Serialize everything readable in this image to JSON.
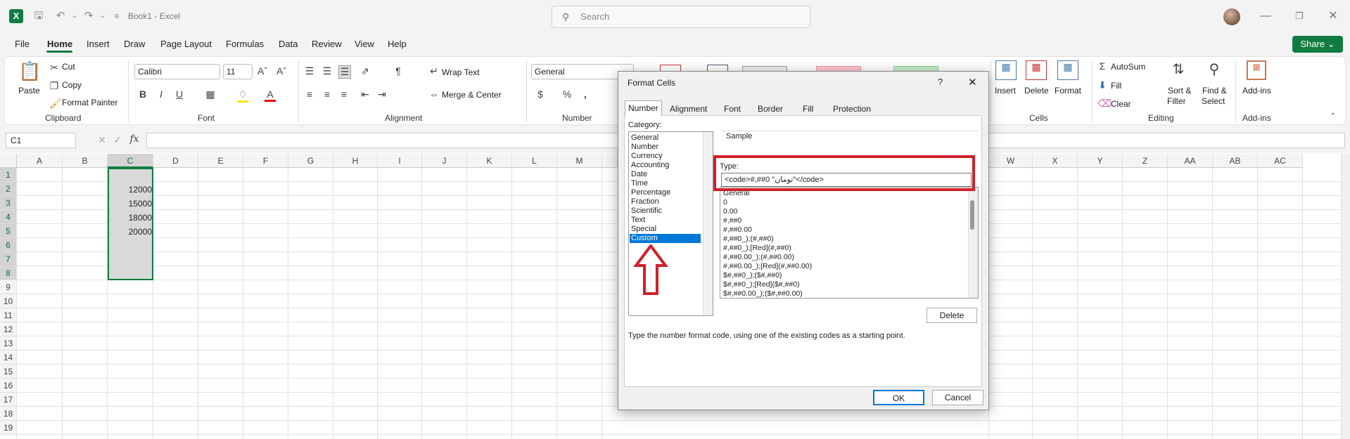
{
  "window": {
    "title": "Book1  -  Excel",
    "search_placeholder": "Search"
  },
  "menu": [
    "File",
    "Home",
    "Insert",
    "Draw",
    "Page Layout",
    "Formulas",
    "Data",
    "Review",
    "View",
    "Help"
  ],
  "share_label": "Share",
  "ribbon": {
    "paste": "Paste",
    "cut": "Cut",
    "copy": "Copy",
    "format_painter": "Format Painter",
    "clipboard": "Clipboard",
    "font_name": "Calibri",
    "font_size": "11",
    "font_group": "Font",
    "wrap_text": "Wrap Text",
    "merge_center": "Merge & Center",
    "alignment_group": "Alignment",
    "number_format": "General",
    "number_group": "Number",
    "insert": "Insert",
    "delete": "Delete",
    "format": "Format",
    "cells_group": "Cells",
    "autosum": "AutoSum",
    "fill": "Fill",
    "clear": "Clear",
    "sort_filter_1": "Sort &",
    "sort_filter_2": "Filter",
    "find_select_1": "Find &",
    "find_select_2": "Select",
    "editing_group": "Editing",
    "addins": "Add-ins",
    "addins_group": "Add-ins"
  },
  "name_box": "C1",
  "columns": [
    "A",
    "B",
    "C",
    "D",
    "E",
    "F",
    "G",
    "H",
    "I",
    "J",
    "K",
    "L",
    "M"
  ],
  "columns_right": [
    "X",
    "Y",
    "Z",
    "AA",
    "AB",
    "AC"
  ],
  "col_w": "W",
  "rows": [
    "1",
    "2",
    "3",
    "4",
    "5",
    "6",
    "7",
    "8",
    "9",
    "10",
    "11",
    "12",
    "13",
    "14",
    "15",
    "16",
    "17",
    "18",
    "19"
  ],
  "cells": {
    "c2": "12000",
    "c3": "15000",
    "c4": "18000",
    "c5": "20000"
  },
  "dialog": {
    "title": "Format Cells",
    "help": "?",
    "close": "✕",
    "tabs": [
      "Number",
      "Alignment",
      "Font",
      "Border",
      "Fill",
      "Protection"
    ],
    "category_label": "Category:",
    "categories": [
      "General",
      "Number",
      "Currency",
      "Accounting",
      "Date",
      "Time",
      "Percentage",
      "Fraction",
      "Scientific",
      "Text",
      "Special",
      "Custom"
    ],
    "sample_label": "Sample",
    "type_label": "Type:",
    "type_value": "<code>#,##0 \"تومان\"</code>",
    "formats": [
      "General",
      "0",
      "0.00",
      "#,##0",
      "#,##0.00",
      "#,##0_);(#,##0)",
      "#,##0_);[Red](#,##0)",
      "#,##0.00_);(#,##0.00)",
      "#,##0.00_);[Red](#,##0.00)",
      "$#,##0_);($#,##0)",
      "$#,##0_);[Red]($#,##0)",
      "$#,##0.00_);($#,##0.00)"
    ],
    "delete": "Delete",
    "hint": "Type the number format code, using one of the existing codes as a starting point.",
    "ok": "OK",
    "cancel": "Cancel"
  },
  "colors": {
    "excel_green": "#107c41",
    "highlight_red": "#d0202a",
    "selection_blue": "#0078d7"
  }
}
